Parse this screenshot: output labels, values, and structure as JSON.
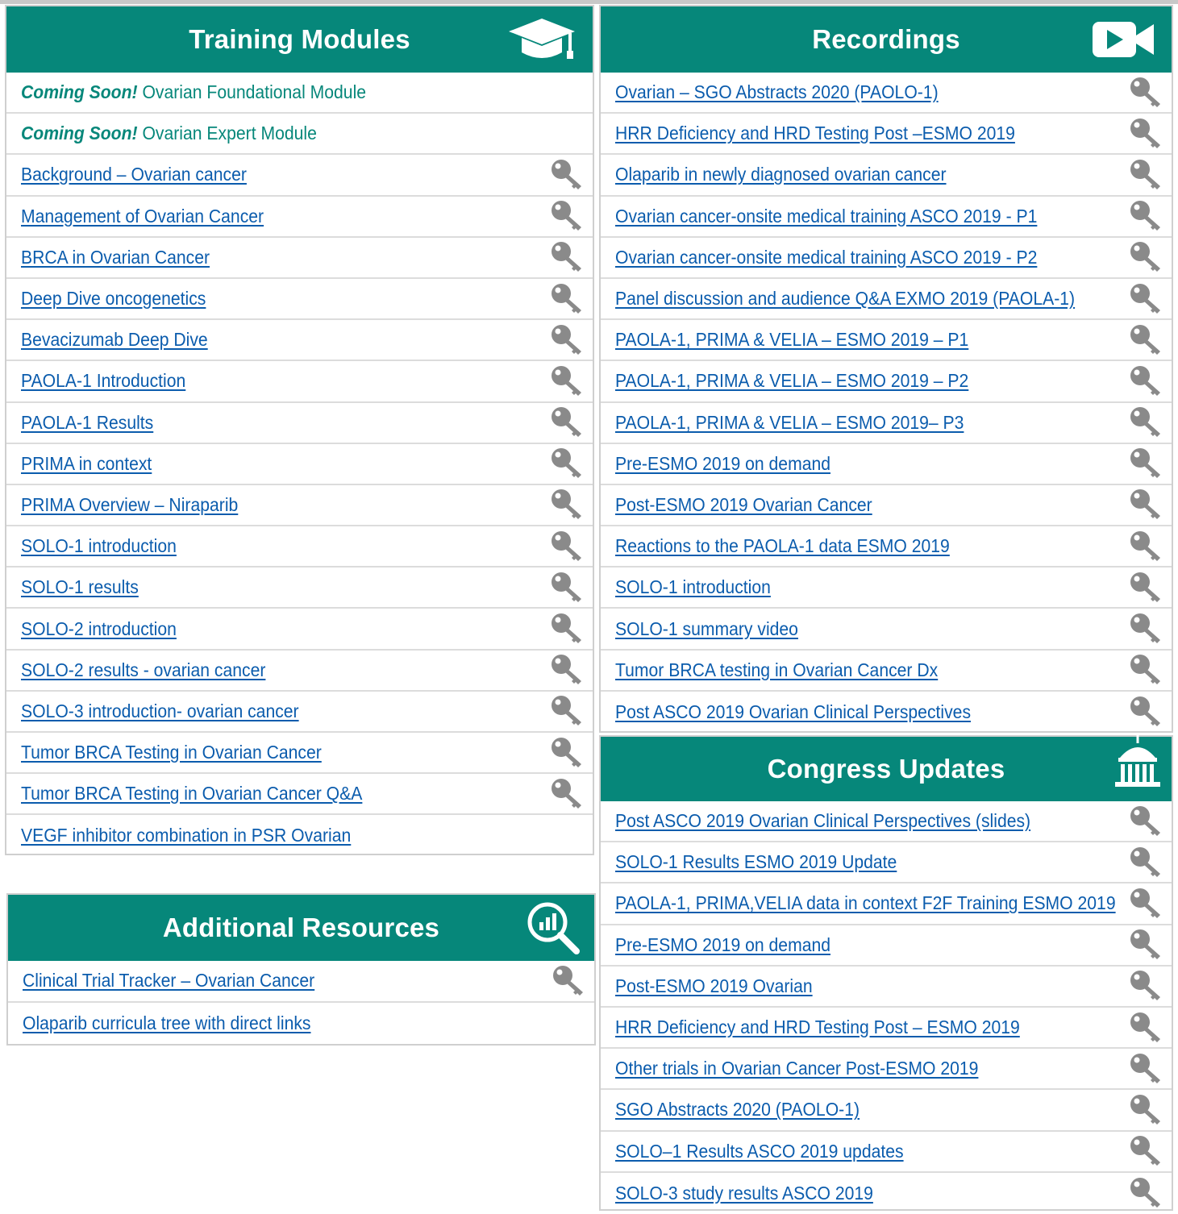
{
  "training": {
    "title": "Training Modules",
    "icon": "graduation-cap-icon",
    "items": [
      {
        "soon": "Coming Soon!",
        "label": "Ovarian Foundational Module",
        "key": false
      },
      {
        "soon": "Coming Soon!",
        "label": "Ovarian Expert Module",
        "key": false
      },
      {
        "label": "Background – Ovarian cancer",
        "key": true
      },
      {
        "label": "Management of Ovarian Cancer",
        "key": true
      },
      {
        "label": "BRCA in Ovarian Cancer",
        "key": true
      },
      {
        "label": "Deep Dive oncogenetics",
        "key": true
      },
      {
        "label": "Bevacizumab Deep Dive",
        "key": true
      },
      {
        "label": "PAOLA-1 Introduction",
        "key": true
      },
      {
        "label": "PAOLA-1 Results",
        "key": true
      },
      {
        "label": "PRIMA in context",
        "key": true
      },
      {
        "label": "PRIMA Overview – Niraparib",
        "key": true
      },
      {
        "label": "SOLO-1 introduction",
        "key": true
      },
      {
        "label": "SOLO-1 results",
        "key": true
      },
      {
        "label": "SOLO-2 introduction",
        "key": true
      },
      {
        "label": "SOLO-2 results - ovarian cancer",
        "key": true
      },
      {
        "label": "SOLO-3 introduction- ovarian cancer",
        "key": true
      },
      {
        "label": "Tumor BRCA Testing in Ovarian Cancer",
        "key": true
      },
      {
        "label": "Tumor BRCA Testing in Ovarian Cancer Q&A",
        "key": true
      },
      {
        "label": "VEGF inhibitor combination in PSR Ovarian",
        "key": false
      }
    ]
  },
  "additional": {
    "title": "Additional Resources",
    "icon": "chart-magnifier-icon",
    "items": [
      {
        "label": "Clinical Trial Tracker – Ovarian Cancer",
        "key": true
      },
      {
        "label": "Olaparib curricula tree with direct links",
        "key": false
      }
    ]
  },
  "recordings": {
    "title": "Recordings",
    "icon": "video-camera-icon",
    "items": [
      {
        "label": "Ovarian – SGO Abstracts 2020 (PAOLO-1)",
        "key": true
      },
      {
        "label": "HRR Deficiency and HRD Testing Post –ESMO 2019",
        "key": true
      },
      {
        "label": "Olaparib in newly diagnosed ovarian cancer",
        "key": true
      },
      {
        "label": "Ovarian cancer-onsite medical training ASCO 2019 - P1",
        "key": true
      },
      {
        "label": "Ovarian cancer-onsite medical training ASCO 2019 - P2",
        "key": true
      },
      {
        "label": "Panel discussion and audience Q&A EXMO 2019 (PAOLA-1)",
        "key": true
      },
      {
        "label": "PAOLA-1, PRIMA & VELIA – ESMO 2019 – P1",
        "key": true
      },
      {
        "label": "PAOLA-1, PRIMA & VELIA – ESMO 2019 – P2",
        "key": true
      },
      {
        "label": "PAOLA-1, PRIMA & VELIA – ESMO 2019– P3",
        "key": true
      },
      {
        "label": "Pre-ESMO 2019 on demand",
        "key": true
      },
      {
        "label": "Post-ESMO 2019 Ovarian Cancer",
        "key": true
      },
      {
        "label": "Reactions to the PAOLA-1 data ESMO 2019",
        "key": true
      },
      {
        "label": "SOLO-1 introduction",
        "key": true
      },
      {
        "label": "SOLO-1 summary video",
        "key": true
      },
      {
        "label": "Tumor BRCA testing in Ovarian Cancer Dx",
        "key": true
      },
      {
        "label": "Post ASCO 2019 Ovarian Clinical Perspectives",
        "key": true
      }
    ]
  },
  "congress": {
    "title": "Congress Updates",
    "icon": "capitol-building-icon",
    "items": [
      {
        "label": "Post ASCO 2019 Ovarian Clinical Perspectives (slides)",
        "key": true
      },
      {
        "label": "SOLO-1 Results ESMO 2019 Update",
        "key": true
      },
      {
        "label": "PAOLA-1, PRIMA,VELIA data in context F2F Training ESMO 2019",
        "key": true
      },
      {
        "label": "Pre-ESMO 2019 on demand",
        "key": true
      },
      {
        "label": "Post-ESMO 2019 Ovarian",
        "key": true
      },
      {
        "label": "HRR Deficiency and HRD Testing Post – ESMO 2019",
        "key": true
      },
      {
        "label": "Other trials in Ovarian Cancer Post-ESMO 2019",
        "key": true
      },
      {
        "label": "SGO Abstracts 2020 (PAOLO-1)",
        "key": true
      },
      {
        "label": "SOLO–1 Results ASCO 2019 updates",
        "key": true
      },
      {
        "label": "SOLO-3 study results ASCO 2019",
        "key": true
      }
    ]
  },
  "colors": {
    "header": "#06877a",
    "link": "#0b5cad",
    "key_icon": "#8a8a8a"
  }
}
